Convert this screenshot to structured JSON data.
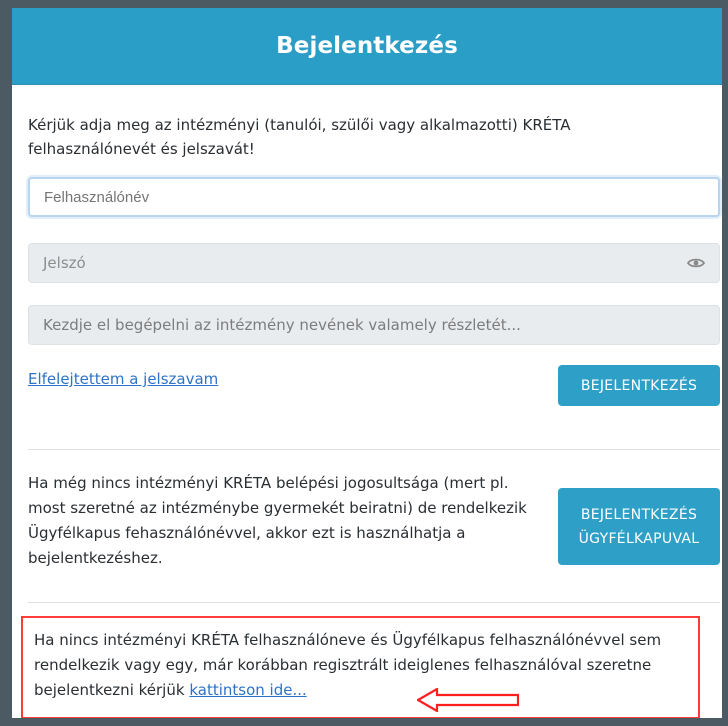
{
  "header": {
    "title": "Bejelentkezés"
  },
  "intro": {
    "text": "Kérjük adja meg az intézményi (tanulói, szülői vagy alkalmazotti) KRÉTA felhasználónevét és jelszavát!"
  },
  "form": {
    "username_placeholder": "Felhasználónév",
    "password_placeholder": "Jelszó",
    "institution_placeholder": "Kezdje el begépelni az intézmény nevének valamely részletét...",
    "forgot_password": "Elfelejtettem a jelszavam",
    "login_button": "BEJELENTKEZÉS"
  },
  "client_gate": {
    "text": "Ha még nincs intézményi KRÉTA belépési jogosultsága (mert pl. most szeretné az intézménybe gyermekét beiratni) de rendelkezik Ügyfélkapus fehasználónévvel, akkor ezt is használhatja a bejelentkezéshez.",
    "button_line_1": "BEJELENTKEZÉS",
    "button_line_2": "ÜGYFÉLKAPUVAL"
  },
  "note": {
    "text": "Ha nincs intézményi KRÉTA felhasználóneve és Ügyfélkapus felhasználónévvel sem rendelkezik vagy egy, már korábban regisztrált ideiglenes felhasználóval szeretne bejelentkezni kérjük",
    "link": "kattintson ide..."
  },
  "colors": {
    "accent": "#2b9ec7",
    "link": "#2d73c6",
    "highlight_box": "#ff3b3b",
    "arrow": "#ff1f1f"
  },
  "icons": {
    "password_visibility": "eye-icon",
    "note_arrow": "left-arrow-icon"
  }
}
